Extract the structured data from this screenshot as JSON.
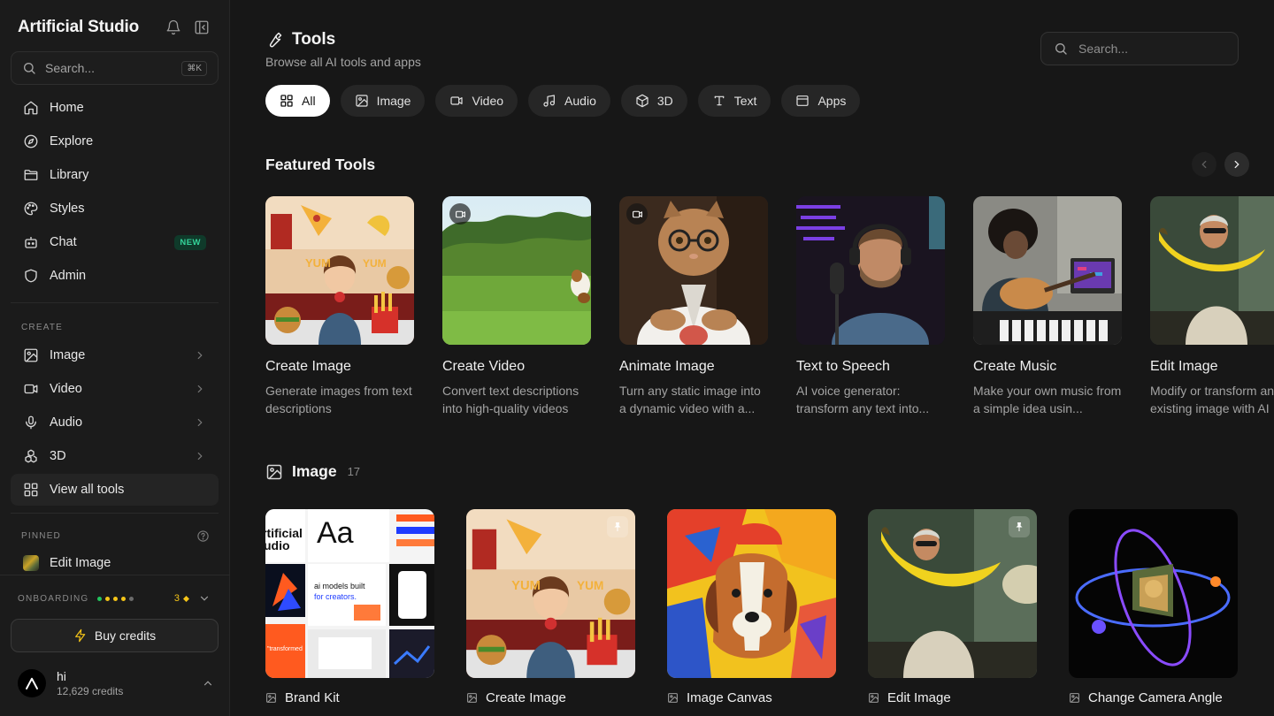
{
  "sidebar": {
    "brand": "Artificial Studio",
    "search": {
      "placeholder": "Search...",
      "shortcut": "⌘K"
    },
    "nav": [
      {
        "label": "Home",
        "icon": "home-icon"
      },
      {
        "label": "Explore",
        "icon": "compass-icon"
      },
      {
        "label": "Library",
        "icon": "folder-icon"
      },
      {
        "label": "Styles",
        "icon": "palette-icon"
      },
      {
        "label": "Chat",
        "icon": "bot-icon",
        "badge": "NEW"
      },
      {
        "label": "Admin",
        "icon": "shield-icon"
      }
    ],
    "create_label": "CREATE",
    "create_items": [
      {
        "label": "Image",
        "icon": "image-icon"
      },
      {
        "label": "Video",
        "icon": "video-icon"
      },
      {
        "label": "Audio",
        "icon": "microphone-icon"
      },
      {
        "label": "3D",
        "icon": "cubes-icon"
      }
    ],
    "view_all": "View all tools",
    "pinned_label": "PINNED",
    "pinned_items": [
      {
        "label": "Edit Image"
      }
    ],
    "onboarding": {
      "label": "ONBOARDING",
      "dot_colors": [
        "#22c55e",
        "#f5c518",
        "#f5c518",
        "#f5c518",
        "#6b6b6b"
      ],
      "count": "3"
    },
    "buy_credits": "Buy credits",
    "user": {
      "name": "hi",
      "credits": "12,629 credits"
    }
  },
  "header": {
    "title": "Tools",
    "subtitle": "Browse all AI tools and apps",
    "search_placeholder": "Search..."
  },
  "filters": [
    {
      "label": "All",
      "icon": "grid-icon",
      "active": true
    },
    {
      "label": "Image",
      "icon": "image-icon"
    },
    {
      "label": "Video",
      "icon": "video-icon"
    },
    {
      "label": "Audio",
      "icon": "music-icon"
    },
    {
      "label": "3D",
      "icon": "cube-icon"
    },
    {
      "label": "Text",
      "icon": "text-icon"
    },
    {
      "label": "Apps",
      "icon": "window-icon"
    }
  ],
  "featured": {
    "title": "Featured Tools",
    "items": [
      {
        "name": "Create Image",
        "desc": "Generate images from text descriptions",
        "video": false
      },
      {
        "name": "Create Video",
        "desc": "Convert text descriptions into high-quality videos",
        "video": true
      },
      {
        "name": "Animate Image",
        "desc": "Turn any static image into a dynamic video with a...",
        "video": true
      },
      {
        "name": "Text to Speech",
        "desc": "AI voice generator: transform any text into...",
        "video": false
      },
      {
        "name": "Create Music",
        "desc": "Make your own music from a simple idea usin...",
        "video": false
      },
      {
        "name": "Edit Image",
        "desc": "Modify or transform an existing image with AI",
        "video": false
      }
    ]
  },
  "image_section": {
    "title": "Image",
    "count": "17",
    "items": [
      {
        "name": "Brand Kit",
        "pinned": false
      },
      {
        "name": "Create Image",
        "pinned": true
      },
      {
        "name": "Image Canvas",
        "pinned": false
      },
      {
        "name": "Edit Image",
        "pinned": true
      },
      {
        "name": "Change Camera Angle",
        "pinned": false
      }
    ]
  }
}
